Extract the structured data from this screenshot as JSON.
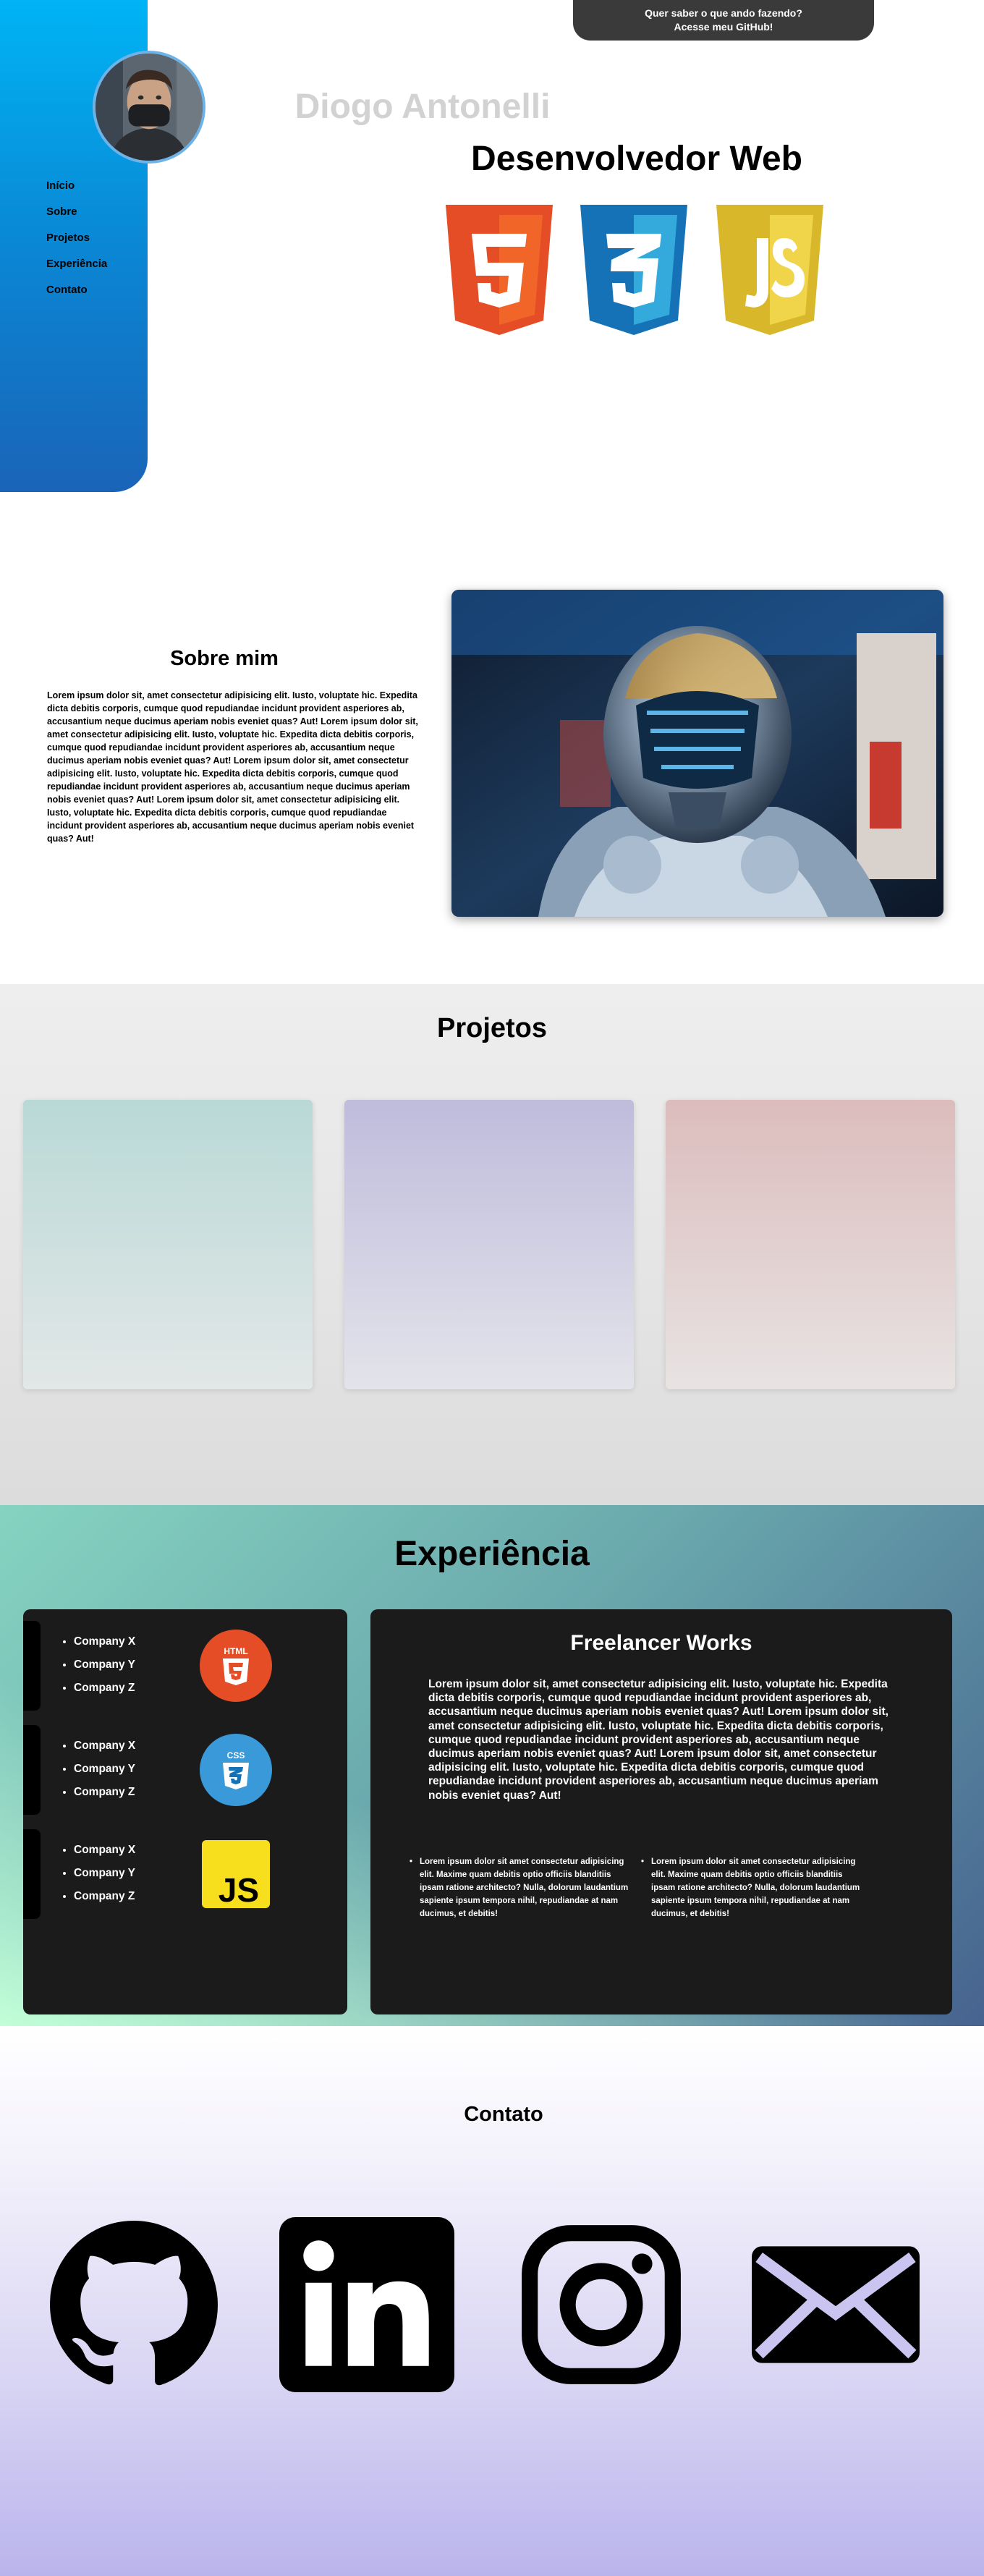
{
  "sidebar": {
    "items": [
      {
        "label": "Início"
      },
      {
        "label": "Sobre"
      },
      {
        "label": "Projetos"
      },
      {
        "label": "Experiência"
      },
      {
        "label": "Contato"
      }
    ]
  },
  "banner": {
    "line1": "Quer saber o que ando fazendo?",
    "line2": "Acesse meu GitHub!"
  },
  "hero": {
    "name": "Diogo Antonelli",
    "role": "Desenvolvedor Web",
    "tech_icons": [
      "html5-icon",
      "css3-icon",
      "javascript-icon"
    ]
  },
  "about": {
    "title": "Sobre mim",
    "text": "Lorem ipsum dolor sit, amet consectetur adipisicing elit. Iusto, voluptate hic. Expedita dicta debitis corporis, cumque quod repudiandae incidunt provident asperiores ab, accusantium neque ducimus aperiam nobis eveniet quas? Aut! Lorem ipsum dolor sit, amet consectetur adipisicing elit. Iusto, voluptate hic. Expedita dicta debitis corporis, cumque quod repudiandae incidunt provident asperiores ab, accusantium neque ducimus aperiam nobis eveniet quas? Aut! Lorem ipsum dolor sit, amet consectetur adipisicing elit. Iusto, voluptate hic. Expedita dicta debitis corporis, cumque quod repudiandae incidunt provident asperiores ab, accusantium neque ducimus aperiam nobis eveniet quas? Aut! Lorem ipsum dolor sit, amet consectetur adipisicing elit. Iusto, voluptate hic. Expedita dicta debitis corporis, cumque quod repudiandae incidunt provident asperiores ab, accusantium neque ducimus aperiam nobis eveniet quas? Aut!"
  },
  "projects": {
    "title": "Projetos",
    "cards": [
      {
        "top_color": "#b9d9d6"
      },
      {
        "top_color": "#bfbcdc"
      },
      {
        "top_color": "#dcbcbc"
      }
    ]
  },
  "experience": {
    "title": "Experiência",
    "groups": [
      {
        "companies": [
          "Company X",
          "Company Y",
          "Company Z"
        ],
        "icon": "html5-icon"
      },
      {
        "companies": [
          "Company X",
          "Company Y",
          "Company Z"
        ],
        "icon": "css3-icon"
      },
      {
        "companies": [
          "Company X",
          "Company Y",
          "Company Z"
        ],
        "icon": "javascript-icon"
      }
    ],
    "detail": {
      "title": "Freelancer Works",
      "text": "Lorem ipsum dolor sit, amet consectetur adipisicing elit. Iusto, voluptate hic. Expedita dicta debitis corporis, cumque quod repudiandae incidunt provident asperiores ab, accusantium neque ducimus aperiam nobis eveniet quas? Aut! Lorem ipsum dolor sit, amet consectetur adipisicing elit. Iusto, voluptate hic. Expedita dicta debitis corporis, cumque quod repudiandae incidunt provident asperiores ab, accusantium neque ducimus aperiam nobis eveniet quas? Aut! Lorem ipsum dolor sit, amet consectetur adipisicing elit. Iusto, voluptate hic. Expedita dicta debitis corporis, cumque quod repudiandae incidunt provident asperiores ab, accusantium neque ducimus aperiam nobis eveniet quas? Aut!",
      "bullets": [
        "Lorem ipsum dolor sit amet consectetur adipisicing elit. Maxime quam debitis optio officiis blanditiis ipsam ratione architecto? Nulla, dolorum laudantium sapiente ipsum tempora nihil, repudiandae at nam ducimus, et debitis!",
        "Lorem ipsum dolor sit amet consectetur adipisicing elit. Maxime quam debitis optio officiis blanditiis ipsam ratione architecto? Nulla, dolorum laudantium sapiente ipsum tempora nihil, repudiandae at nam ducimus, et debitis!"
      ]
    }
  },
  "contact": {
    "title": "Contato",
    "icons": [
      "github-icon",
      "linkedin-icon",
      "instagram-icon",
      "mail-icon"
    ]
  },
  "colors": {
    "sidebar_top": "#00b4f5",
    "sidebar_bottom": "#1a64b8",
    "html5": "#e44d26",
    "css3": "#1572b6",
    "javascript": "#d9b72b",
    "dark_card": "#1b1b1b"
  }
}
